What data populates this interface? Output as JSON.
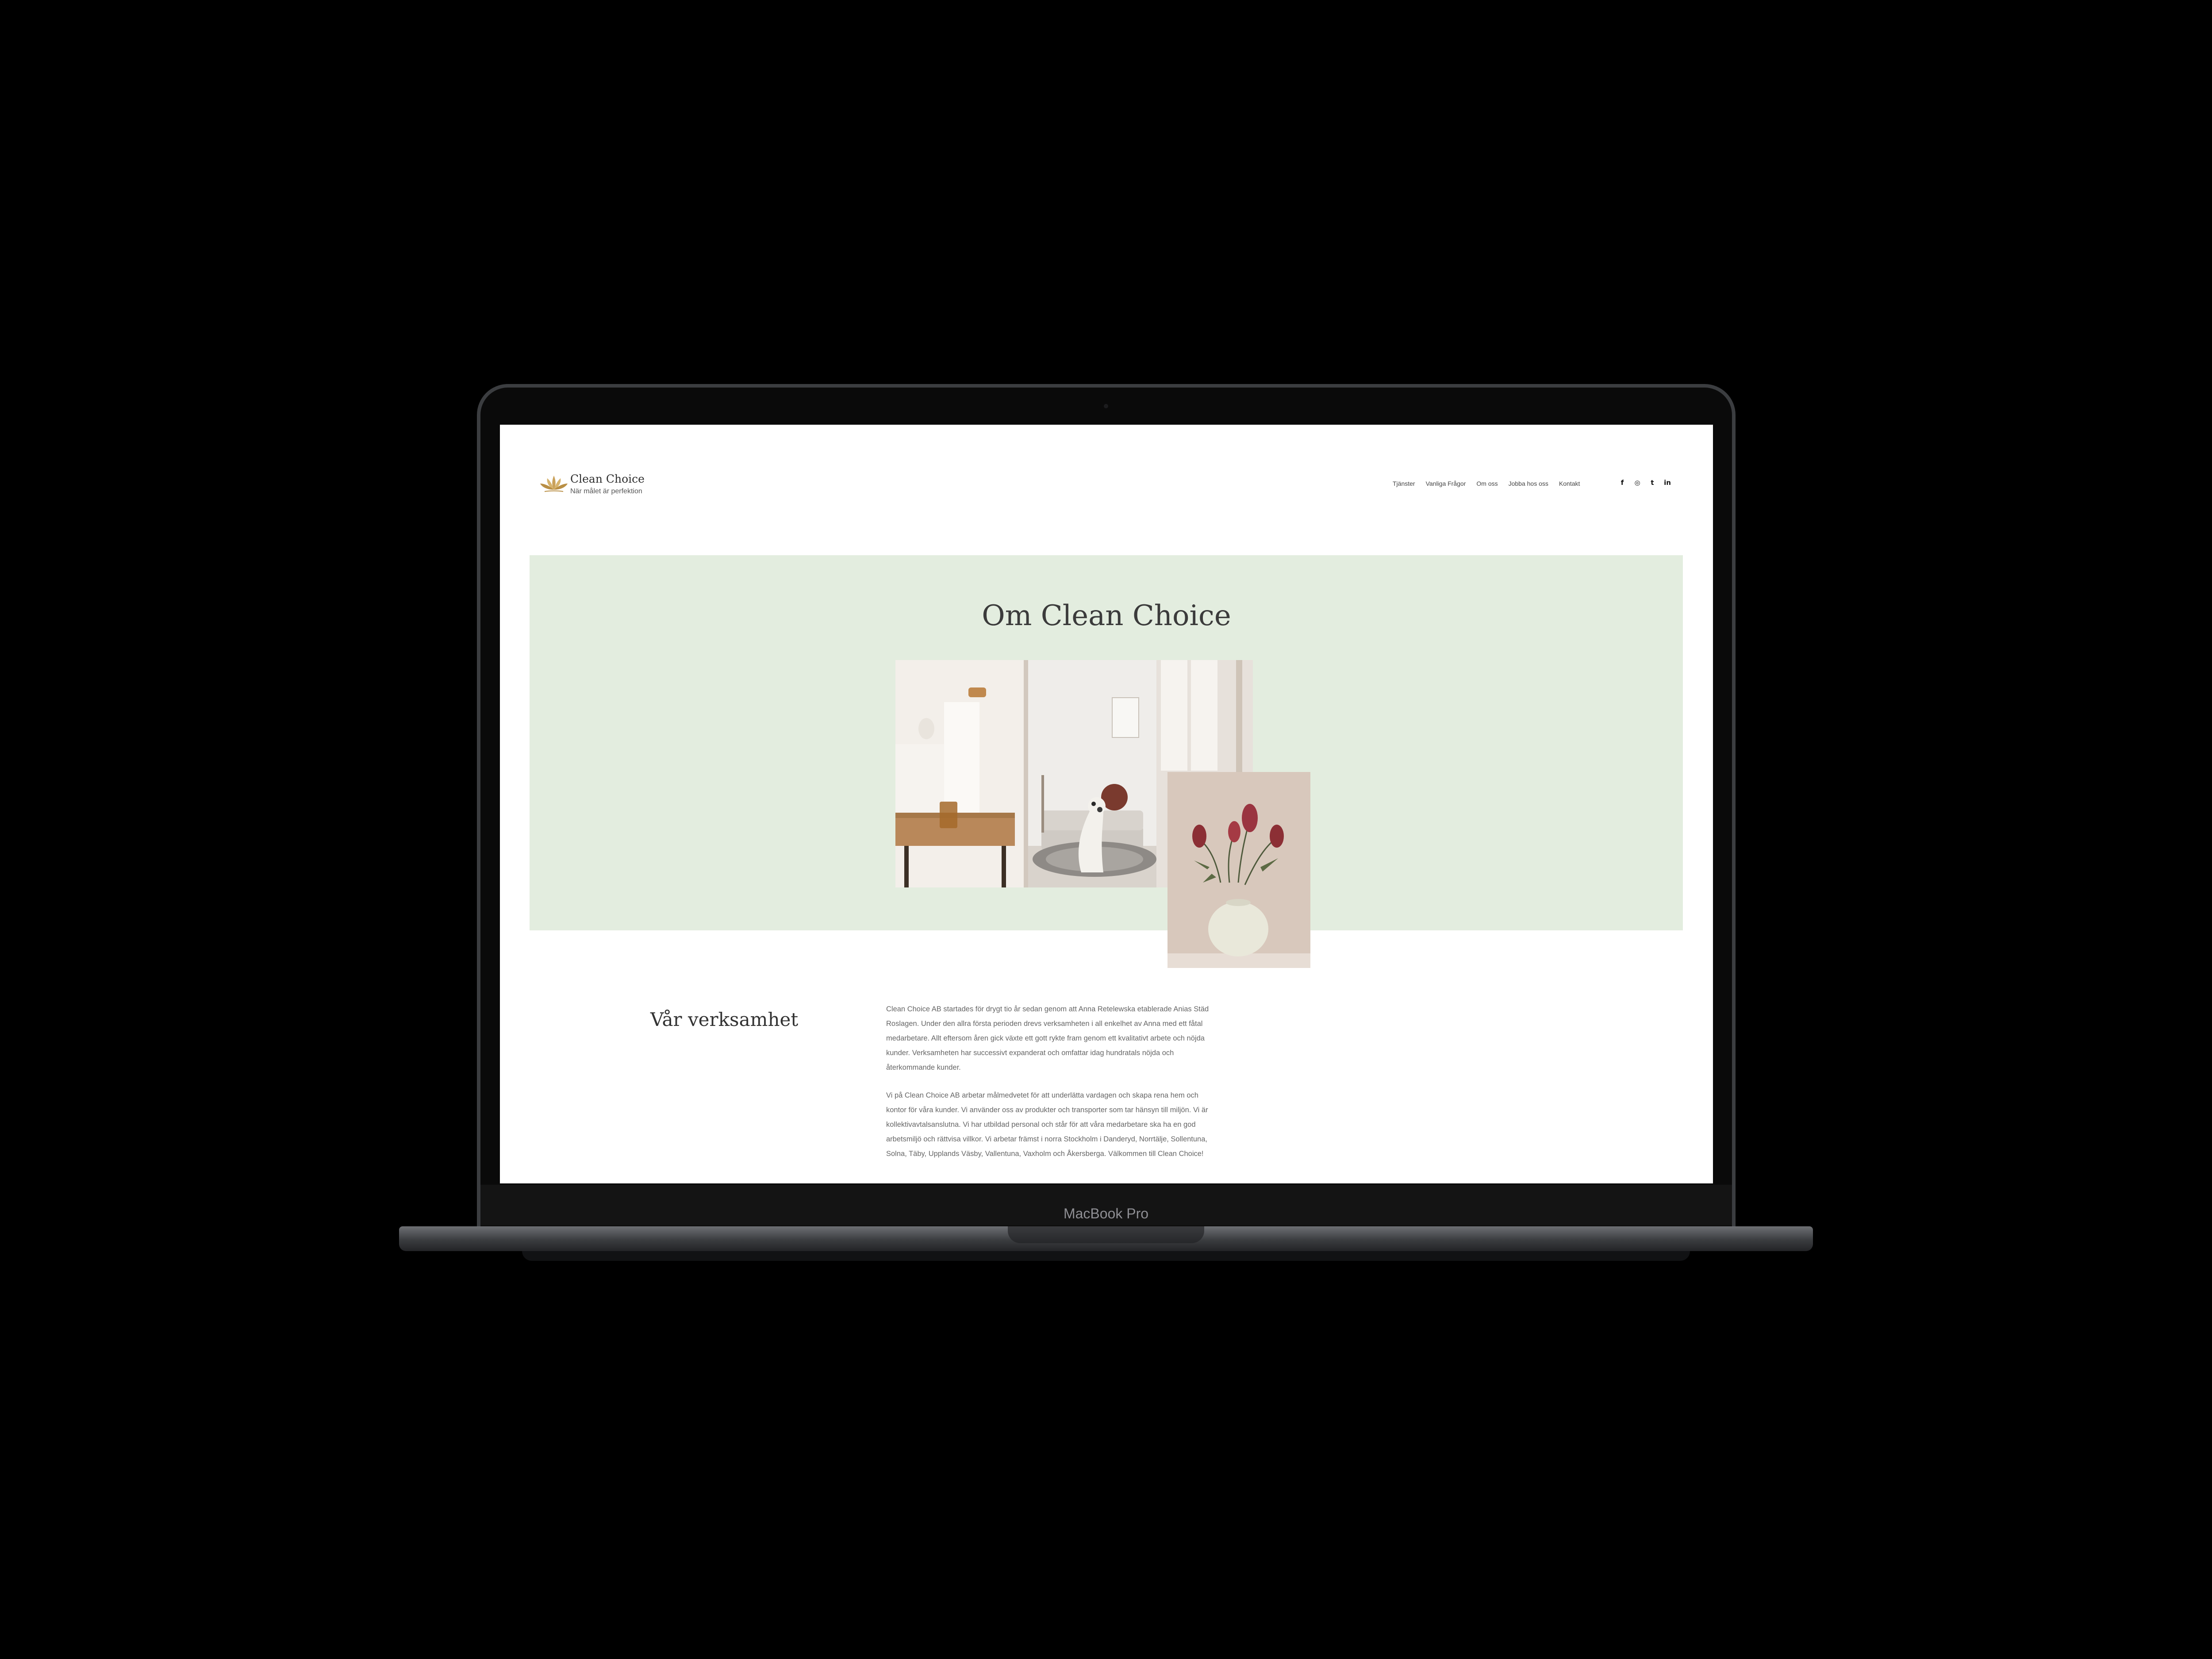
{
  "device": {
    "label": "MacBook Pro"
  },
  "site": {
    "title": "Clean Choice",
    "tagline": "När målet är perfektion",
    "nav": [
      "Tjänster",
      "Vanliga Frågor",
      "Om oss",
      "Jobba hos oss",
      "Kontakt"
    ],
    "social_icons": [
      "facebook-icon",
      "instagram-icon",
      "twitter-icon",
      "linkedin-icon"
    ],
    "social_glyphs": [
      "f",
      "◎",
      "t",
      "in"
    ]
  },
  "hero": {
    "title": "Om Clean Choice",
    "background_color": "#e3eddf"
  },
  "section": {
    "title": "Vår verksamhet",
    "paragraphs": [
      "Clean Choice AB startades för drygt tio år sedan genom att Anna Retelewska etablerade Anias Städ Roslagen. Under den allra första perioden drevs verksamheten i all enkelhet av Anna med ett fåtal medarbetare. Allt eftersom åren gick växte ett gott rykte fram genom ett kvalitativt arbete och nöjda kunder. Verksamheten har successivt expanderat och omfattar idag hundratals nöjda och återkommande kunder.",
      "Vi på Clean Choice AB arbetar målmedvetet för att underlätta vardagen och skapa rena hem och kontor för våra kunder. Vi använder oss av produkter och transporter som tar hänsyn till miljön. Vi är kollektivavtalsanslutna. Vi har utbildad personal och står för att våra medarbetare ska ha en god arbetsmiljö och rättvisa villkor. Vi arbetar främst i norra Stockholm i Danderyd, Norrtälje, Sollentuna, Solna, Täby, Upplands Väsby, Vallentuna, Vaxholm och Åkersberga. Välkommen till Clean Choice!"
    ]
  }
}
